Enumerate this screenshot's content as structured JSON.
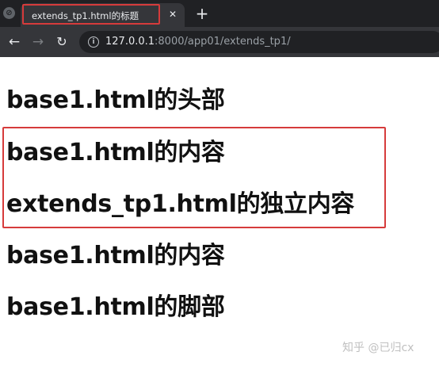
{
  "browser": {
    "tab": {
      "title": "extends_tp1.html的标题",
      "close_glyph": "✕",
      "favicon_glyph": "⊘"
    },
    "new_tab_glyph": "+",
    "nav": {
      "back_glyph": "←",
      "forward_glyph": "→",
      "reload_glyph": "↻"
    },
    "address_bar": {
      "info_glyph": "i",
      "url_host": "127.0.0.1",
      "url_path": ":8000/app01/extends_tp1/"
    }
  },
  "page": {
    "headings": [
      "base1.html的头部",
      "base1.html的内容",
      "extends_tp1.html的独立内容",
      "base1.html的内容",
      "base1.html的脚部"
    ]
  },
  "watermark": "知乎 @已归cx",
  "colors": {
    "highlight": "#d63b3b",
    "chrome_dark": "#202124",
    "chrome_tab": "#35363a",
    "text": "#111111"
  }
}
